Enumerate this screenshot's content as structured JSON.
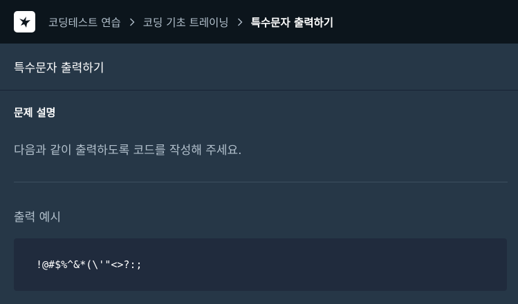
{
  "header": {
    "logo_icon": "bird-logo-icon",
    "breadcrumbs": [
      {
        "label": "코딩테스트 연습"
      },
      {
        "label": "코딩 기초 트레이닝"
      },
      {
        "label": "특수문자 출력하기"
      }
    ]
  },
  "title_bar": {
    "title": "특수문자 출력하기"
  },
  "problem": {
    "heading": "문제 설명",
    "text": "다음과 같이 출력하도록 코드를 작성해 주세요."
  },
  "example": {
    "heading": "출력 예시",
    "code": "!@#$%^&*(\\'\"<>?:;"
  },
  "colors": {
    "topbar_bg": "#0c151c",
    "page_bg": "#263747",
    "code_bg": "#202b3d",
    "muted_text": "#b2c0cc"
  }
}
